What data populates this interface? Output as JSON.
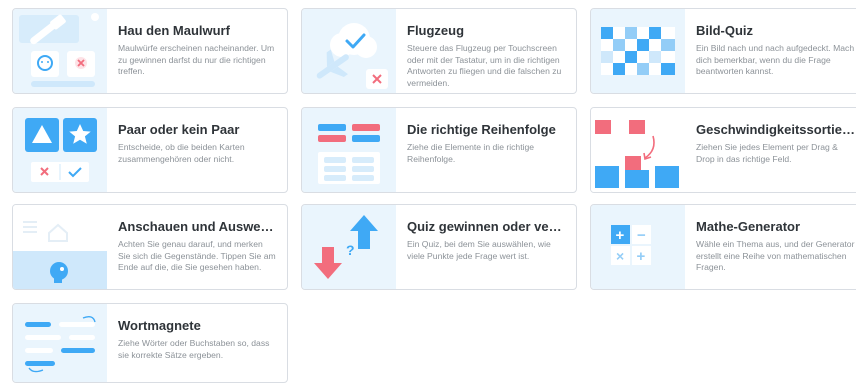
{
  "cards": [
    {
      "title": "Hau den Maulwurf",
      "description": "Maulwürfe erscheinen nacheinander. Um zu gewinnen darfst du nur die richtigen treffen.",
      "icon": "whack-a-mole-icon"
    },
    {
      "title": "Flugzeug",
      "description": "Steuere das Flugzeug per Touchscreen oder mit der Tastatur, um in die richtigen Antworten zu fliegen und die falschen zu vermeiden.",
      "icon": "airplane-icon"
    },
    {
      "title": "Bild-Quiz",
      "description": "Ein Bild nach und nach aufgedeckt. Mach dich bemerkbar, wenn du die Frage beantworten kannst.",
      "icon": "image-quiz-icon"
    },
    {
      "title": "Paar oder kein Paar",
      "description": "Entscheide, ob die beiden Karten zusammengehören oder nicht.",
      "icon": "pair-shapes-icon"
    },
    {
      "title": "Die richtige Reihenfolge",
      "description": "Ziehe die Elemente in die richtige Reihenfolge.",
      "icon": "ordering-icon"
    },
    {
      "title": "Geschwindigkeitssortierung",
      "description": "Ziehen Sie jedes Element per Drag & Drop in das richtige Feld.",
      "icon": "speed-sort-icon"
    },
    {
      "title": "Anschauen und Auswendig...",
      "description": "Achten Sie genau darauf, und merken Sie sich die Gegenstände. Tippen Sie am Ende auf die, die Sie gesehen haben.",
      "icon": "memory-watch-icon"
    },
    {
      "title": "Quiz gewinnen oder verlier...",
      "description": "Ein Quiz, bei dem Sie auswählen, wie viele Punkte jede Frage wert ist.",
      "icon": "win-or-lose-arrows-icon"
    },
    {
      "title": "Mathe-Generator",
      "description": "Wähle ein Thema aus, und der Generator erstellt eine Reihe von mathematischen Fragen.",
      "icon": "math-operators-icon"
    },
    {
      "title": "Wortmagnete",
      "description": "Ziehe Wörter oder Buchstaben so, dass sie korrekte Sätze ergeben.",
      "icon": "word-magnets-icon"
    }
  ],
  "icon_symbols": {
    "plus": "+",
    "minus": "−",
    "times": "×",
    "question": "?"
  },
  "colors": {
    "accent_blue": "#3fa9f5",
    "thumb_bg": "#eaf5fd",
    "red": "#f26d7d",
    "pale_blue": "#cfe8fb"
  }
}
